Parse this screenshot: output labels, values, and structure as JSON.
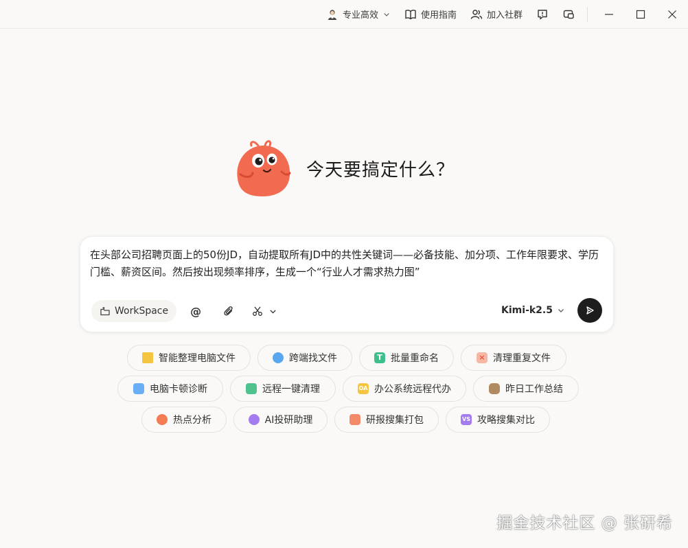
{
  "titlebar": {
    "mode_label": "专业高效",
    "guide_label": "使用指南",
    "community_label": "加入社群"
  },
  "hero": {
    "title": "今天要搞定什么？"
  },
  "composer": {
    "prompt_text": "在头部公司招聘页面上的50份JD，自动提取所有JD中的共性关键词——必备技能、加分项、工作年限要求、学历门槛、薪资区间。然后按出现频率排序，生成一个“行业人才需求热力图”",
    "workspace_label": "WorkSpace",
    "mention_symbol": "@",
    "model_label": "Kimi-k2.5"
  },
  "chips": {
    "row1": [
      {
        "label": "智能整理电脑文件",
        "icon": "folder-icon",
        "color": "#f5c542"
      },
      {
        "label": "跨端找文件",
        "icon": "search-icon",
        "color": "#5aa7f0"
      },
      {
        "label": "批量重命名",
        "icon": "text-t-icon",
        "color": "#3dc08a"
      },
      {
        "label": "清理重复文件",
        "icon": "delete-icon",
        "color": "#f28a6a"
      }
    ],
    "row2": [
      {
        "label": "电脑卡顿诊断",
        "icon": "monitor-icon",
        "color": "#6aaef5"
      },
      {
        "label": "远程一键清理",
        "icon": "robot-icon",
        "color": "#4fc28e"
      },
      {
        "label": "办公系统远程代办",
        "icon": "oa-icon",
        "color": "#f5c542"
      },
      {
        "label": "昨日工作总结",
        "icon": "bag-icon",
        "color": "#b08a60"
      }
    ],
    "row3": [
      {
        "label": "热点分析",
        "icon": "peach-icon",
        "color": "#f47b52"
      },
      {
        "label": "AI投研助理",
        "icon": "sparkle-icon",
        "color": "#a47cf0"
      },
      {
        "label": "研报搜集打包",
        "icon": "box-icon",
        "color": "#f28a6a"
      },
      {
        "label": "攻略搜集对比",
        "icon": "vs-icon",
        "color": "#a47cf0"
      }
    ]
  },
  "watermark": "掘金技术社区 @ 张研希"
}
